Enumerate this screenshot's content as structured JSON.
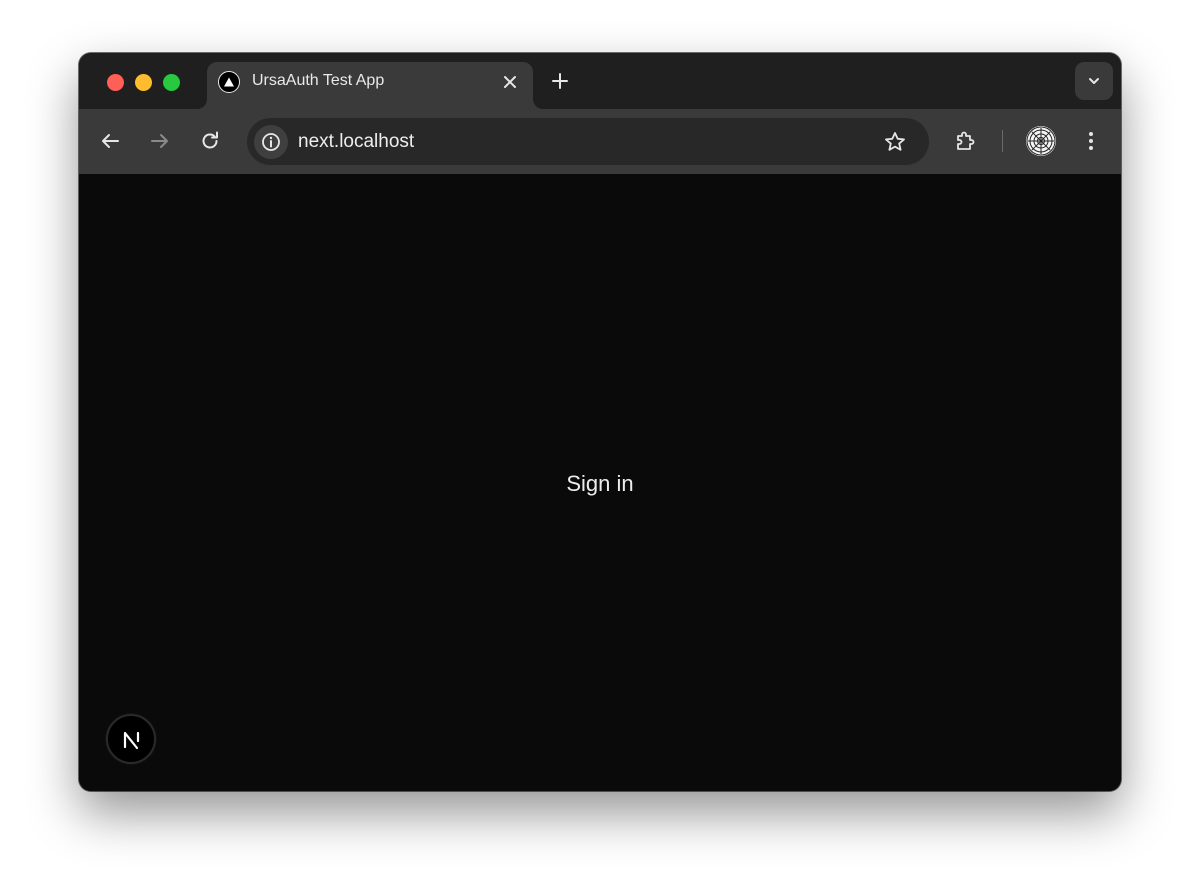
{
  "browser": {
    "tab": {
      "title": "UrsaAuth Test App",
      "favicon": "nextjs-triangle-icon"
    },
    "url": "next.localhost",
    "icons": {
      "back": "arrow-left-icon",
      "forward": "arrow-right-icon",
      "reload": "reload-icon",
      "site_info": "info-icon",
      "bookmark": "star-icon",
      "extensions": "puzzle-icon",
      "profile": "profile-avatar",
      "menu": "more-vertical-icon",
      "new_tab": "plus-icon",
      "tab_close": "close-icon",
      "tab_search": "chevron-down-icon"
    },
    "colors": {
      "close": "#fe5f57",
      "minimize": "#febc2e",
      "maximize": "#28c840",
      "tabstrip": "#1f1f1f",
      "toolbar": "#3a3a3a",
      "omnibox": "#282828"
    }
  },
  "page": {
    "sign_in_label": "Sign in",
    "background": "#0a0a0a",
    "dev_badge": "N"
  }
}
